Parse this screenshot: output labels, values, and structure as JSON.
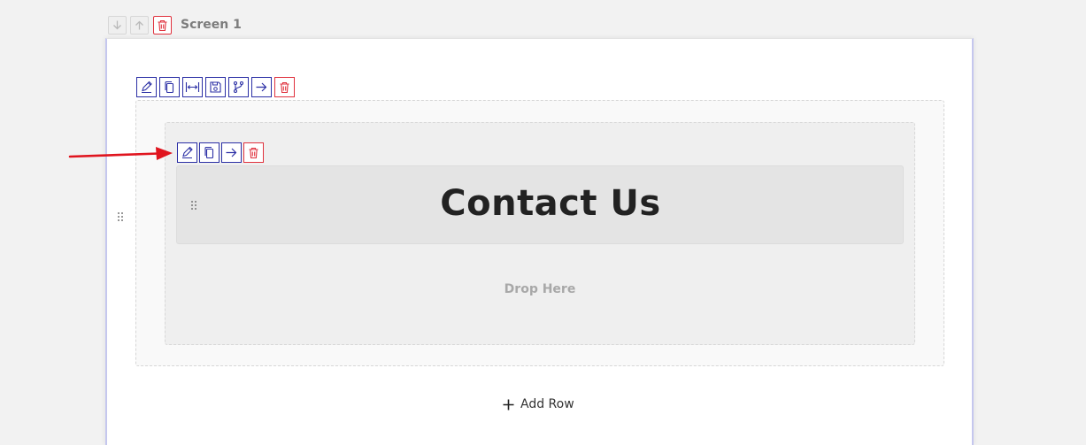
{
  "screen": {
    "title": "Screen 1",
    "controls": [
      {
        "icon": "arrow-down-icon",
        "label": "move-down"
      },
      {
        "icon": "arrow-up-icon",
        "label": "move-up"
      },
      {
        "icon": "trash-icon",
        "label": "delete"
      }
    ]
  },
  "row_toolbar": [
    {
      "icon": "pencil-icon"
    },
    {
      "icon": "copy-icon"
    },
    {
      "icon": "resize-horizontal-icon"
    },
    {
      "icon": "save-icon"
    },
    {
      "icon": "branch-icon"
    },
    {
      "icon": "arrow-right-icon"
    },
    {
      "icon": "trash-icon"
    }
  ],
  "column_toolbar": [
    {
      "icon": "pencil-icon"
    },
    {
      "icon": "copy-icon"
    },
    {
      "icon": "arrow-right-icon"
    },
    {
      "icon": "trash-icon"
    }
  ],
  "heading": {
    "text": "Contact Us"
  },
  "drop_zone": {
    "text": "Drop Here"
  },
  "add_row": {
    "label": "Add Row"
  },
  "colors": {
    "accent": "#2b2fa5",
    "danger": "#e0323e",
    "annotation_arrow": "#e0141e"
  }
}
